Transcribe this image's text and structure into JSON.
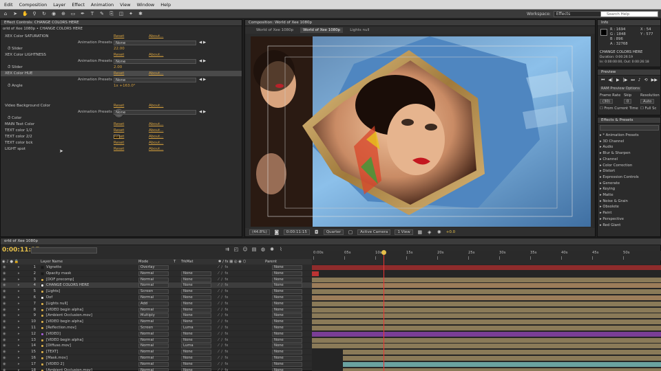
{
  "menu": [
    "Edit",
    "Composition",
    "Layer",
    "Effect",
    "Animation",
    "View",
    "Window",
    "Help"
  ],
  "workspace": {
    "label": "Workspace:",
    "value": "Effects"
  },
  "help_search": "Search Help",
  "effect_controls": {
    "tab": "Effect Controls: CHANGE COLORS HERE",
    "path": "orld of Xee 1080p • CHANGE COLORS HERE",
    "rows": [
      {
        "label": "XEX Color SATURATION",
        "reset": "Reset",
        "about": "About..."
      },
      {
        "label": "Animation Presets",
        "preset": "None"
      },
      {
        "label": "Slider",
        "value": "22.00"
      },
      {
        "label": "XEX Color LIGHTNESS",
        "reset": "Reset",
        "about": "About..."
      },
      {
        "label": "Animation Presets",
        "preset": "None"
      },
      {
        "label": "Slider",
        "value": "2.00"
      },
      {
        "label": "XEX Color HUE",
        "reset": "Reset",
        "about": "About..."
      },
      {
        "label": "Animation Presets",
        "preset": "None"
      },
      {
        "label": "Angle",
        "value": "1x +163.0°"
      },
      {
        "label": "Video Background Color",
        "reset": "Reset",
        "about": "About..."
      },
      {
        "label": "Animation Presets",
        "preset": "None"
      },
      {
        "label": "Color"
      },
      {
        "label": "MAIN Text Color",
        "reset": "Reset",
        "about": "About..."
      },
      {
        "label": "TEXT color 1/2",
        "reset": "Reset",
        "about": "About..."
      },
      {
        "label": "TEXT color 2/2",
        "reset": "Reset",
        "about": "About..."
      },
      {
        "label": "TEXT color bck",
        "reset": "Reset",
        "about": "About..."
      },
      {
        "label": "LIGHT spot",
        "reset": "Reset",
        "about": "About..."
      }
    ]
  },
  "composition": {
    "tab": "Composition: World of Xee 1080p",
    "subtabs": [
      "World of Xee 1080p",
      "World of Xee 1080p",
      "Lights null"
    ],
    "controls": [
      "(44.8%)",
      "0:00:11:15",
      "Quarter",
      "Active Camera",
      "1 View",
      "+0.0"
    ]
  },
  "info": {
    "tab": "Info",
    "r": "R : 1694",
    "g": "G : 1848",
    "b": "B : 896",
    "a": "A : 32768",
    "x": "X : 54",
    "y": "Y : 577",
    "layer": "CHANGE COLORS HERE",
    "duration": "Duration: 0:00:26:19",
    "inout": "In: 0:00:00:00, Out: 0:00:26:18"
  },
  "preview": {
    "tab": "Preview",
    "options": "RAM Preview Options",
    "frame_rate_label": "Frame Rate",
    "skip_label": "Skip",
    "res_label": "Resolution",
    "frame_rate": "(30)",
    "skip": "0",
    "resolution": "Auto",
    "from_current": "From Current Time",
    "full_screen": "Full Sc"
  },
  "effects_presets": {
    "tab": "Effects & Presets",
    "items": [
      "* Animation Presets",
      "3D Channel",
      "Audio",
      "Blur & Sharpen",
      "Channel",
      "Color Correction",
      "Distort",
      "Expression Controls",
      "Generate",
      "Keying",
      "Matte",
      "Noise & Grain",
      "Obsolete",
      "Paint",
      "Perspective",
      "Red Giant"
    ]
  },
  "timeline": {
    "tab": "orld of Xee 1080p",
    "timecode": "0:00:11:15",
    "columns": {
      "name": "Layer Name",
      "mode": "Mode",
      "t": "T",
      "trkmat": "TrkMat",
      "parent": "Parent"
    },
    "ruler": [
      "0:00s",
      "05s",
      "10s",
      "15s",
      "20s",
      "25s",
      "30s",
      "35s",
      "40s",
      "45s",
      "50s"
    ],
    "layers": [
      {
        "num": "1",
        "name": "Vignette",
        "mode": "Overlay",
        "trk": "",
        "parent": "None",
        "color": "#1a1a1a"
      },
      {
        "num": "2",
        "name": "Opacity mask",
        "mode": "Normal",
        "trk": "None",
        "parent": "None",
        "color": "#1a1a1a"
      },
      {
        "num": "3",
        "name": "[DOF precomp]",
        "mode": "Normal",
        "trk": "None",
        "parent": "None",
        "color": "#c9a34a"
      },
      {
        "num": "4",
        "name": "CHANGE COLORS HERE",
        "mode": "Normal",
        "trk": "None",
        "parent": "None",
        "color": "#ffffff"
      },
      {
        "num": "5",
        "name": "[Lights]",
        "mode": "Screen",
        "trk": "None",
        "parent": "None",
        "color": "#c9a34a"
      },
      {
        "num": "6",
        "name": "Dof",
        "mode": "Normal",
        "trk": "None",
        "parent": "None",
        "color": "#dddddd"
      },
      {
        "num": "7",
        "name": "[Lights null]",
        "mode": "Add",
        "trk": "None",
        "parent": "None",
        "color": "#c9a34a"
      },
      {
        "num": "8",
        "name": "[VIDEO begin alpha]",
        "mode": "Normal",
        "trk": "None",
        "parent": "None",
        "color": "#c9a34a"
      },
      {
        "num": "9",
        "name": "[Ambient Occlusion.mov]",
        "mode": "Multiply",
        "trk": "None",
        "parent": "None",
        "color": "#c9a34a"
      },
      {
        "num": "10",
        "name": "[VIDEO begin alpha]",
        "mode": "Normal",
        "trk": "None",
        "parent": "None",
        "color": "#c9a34a"
      },
      {
        "num": "11",
        "name": "[Reflection.mov]",
        "mode": "Screen",
        "trk": "Luma",
        "parent": "None",
        "color": "#c9a34a"
      },
      {
        "num": "12",
        "name": "[VIDEO]",
        "mode": "Normal",
        "trk": "None",
        "parent": "None",
        "color": "#9a5cc8"
      },
      {
        "num": "13",
        "name": "[VIDEO begin alpha]",
        "mode": "Normal",
        "trk": "None",
        "parent": "None",
        "color": "#c9a34a"
      },
      {
        "num": "14",
        "name": "[Diffuse.mov]",
        "mode": "Normal",
        "trk": "Luma",
        "parent": "None",
        "color": "#c9a34a"
      },
      {
        "num": "15",
        "name": "[TEXT]",
        "mode": "Normal",
        "trk": "None",
        "parent": "None",
        "color": "#c9a34a"
      },
      {
        "num": "16",
        "name": "[Mask.mov]",
        "mode": "Normal",
        "trk": "None",
        "parent": "None",
        "color": "#c9a34a"
      },
      {
        "num": "17",
        "name": "[VIDEO 2]",
        "mode": "Normal",
        "trk": "None",
        "parent": "None",
        "color": "#c9a34a"
      },
      {
        "num": "18",
        "name": "[Ambient Occlusion.mov]",
        "mode": "Normal",
        "trk": "None",
        "parent": "None",
        "color": "#c9a34a"
      }
    ]
  },
  "colors": {
    "accent": "#d6a13e",
    "timecode": "#e6c04a",
    "playhead": "#e33333"
  }
}
